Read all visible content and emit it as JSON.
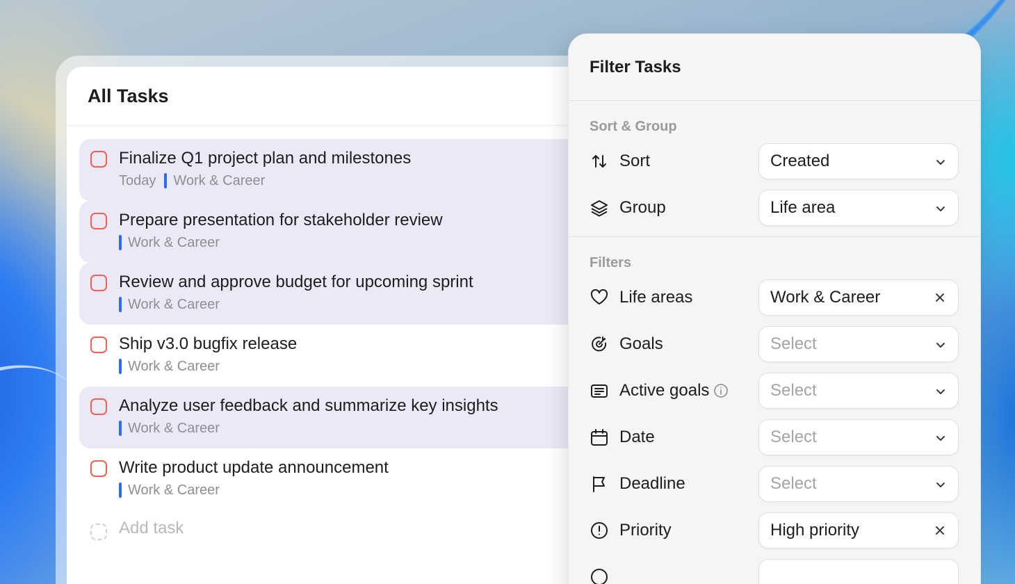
{
  "tasks_panel": {
    "title": "All Tasks",
    "tasks": [
      {
        "title": "Finalize Q1 project plan and milestones",
        "due": "Today",
        "area": "Work & Career",
        "selected": true
      },
      {
        "title": "Prepare presentation for stakeholder review",
        "due": "",
        "area": "Work & Career",
        "selected": true
      },
      {
        "title": "Review and approve budget for upcoming sprint",
        "due": "",
        "area": "Work & Career",
        "selected": true
      },
      {
        "title": "Ship v3.0 bugfix release",
        "due": "",
        "area": "Work & Career",
        "selected": false
      },
      {
        "title": "Analyze user feedback and summarize key insights",
        "due": "",
        "area": "Work & Career",
        "selected": true
      },
      {
        "title": "Write product update announcement",
        "due": "",
        "area": "Work & Career",
        "selected": false
      }
    ],
    "add_task_label": "Add task"
  },
  "filter_panel": {
    "title": "Filter Tasks",
    "sort_group_label": "Sort & Group",
    "sort": {
      "label": "Sort",
      "value": "Created",
      "icon": "sort-arrows-icon"
    },
    "group": {
      "label": "Group",
      "value": "Life area",
      "icon": "layers-icon"
    },
    "filters_label": "Filters",
    "filters": {
      "life_areas": {
        "label": "Life areas",
        "value": "Work & Career",
        "icon": "heart-icon"
      },
      "goals": {
        "label": "Goals",
        "value": "Select",
        "icon": "target-icon"
      },
      "active_goals": {
        "label": "Active goals",
        "value": "Select",
        "icon": "list-icon"
      },
      "date": {
        "label": "Date",
        "value": "Select",
        "icon": "calendar-icon"
      },
      "deadline": {
        "label": "Deadline",
        "value": "Select",
        "icon": "flag-icon"
      },
      "priority": {
        "label": "Priority",
        "value": "High priority",
        "icon": "exclamation-icon"
      }
    }
  },
  "colors": {
    "accent_blue": "#2d6bf0",
    "checkbox_red": "#f0614f",
    "selected_row": "#ebe9f7"
  }
}
